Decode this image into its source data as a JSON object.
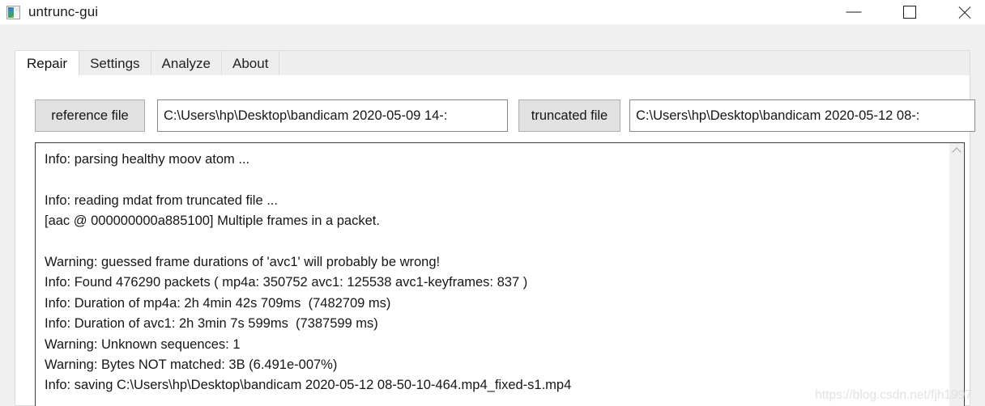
{
  "window": {
    "title": "untrunc-gui",
    "icon": "app-image-icon",
    "controls": {
      "minimize": "—",
      "maximize": "□",
      "close": "✕"
    }
  },
  "tabs": [
    {
      "label": "Repair",
      "active": true
    },
    {
      "label": "Settings",
      "active": false
    },
    {
      "label": "Analyze",
      "active": false
    },
    {
      "label": "About",
      "active": false
    }
  ],
  "repair_tab": {
    "reference_file": {
      "button_label": "reference file",
      "value": "C:\\Users\\hp\\Desktop\\bandicam 2020-05-09 14-:",
      "placeholder": ""
    },
    "truncated_file": {
      "button_label": "truncated file",
      "value": "C:\\Users\\hp\\Desktop\\bandicam 2020-05-12 08-:",
      "placeholder": ""
    },
    "log_lines": [
      "Info: parsing healthy moov atom ...",
      "",
      "Info: reading mdat from truncated file ...",
      "[aac @ 000000000a885100] Multiple frames in a packet.",
      "",
      "Warning: guessed frame durations of 'avc1' will probably be wrong!",
      "Info: Found 476290 packets ( mp4a: 350752 avc1: 125538 avc1-keyframes: 837 )",
      "Info: Duration of mp4a: 2h 4min 42s 709ms  (7482709 ms)",
      "Info: Duration of avc1: 2h 3min 7s 599ms  (7387599 ms)",
      "Warning: Unknown sequences: 1",
      "Warning: Bytes NOT matched: 3B (6.491e-007%)",
      "Info: saving C:\\Users\\hp\\Desktop\\bandicam 2020-05-12 08-50-10-464.mp4_fixed-s1.mp4"
    ],
    "scrollbar": {
      "up_arrow": "chevron-up"
    }
  },
  "watermark": "https://blog.csdn.net/fjh1997",
  "colors": {
    "window_bg": "#f0f0f0",
    "panel_bg": "#ffffff",
    "button_bg": "#e1e1e1",
    "button_border": "#adadad",
    "input_border": "#8a8a8a",
    "log_border": "#3c3c3c",
    "text": "#161616",
    "watermark": "#e2e2e2"
  }
}
